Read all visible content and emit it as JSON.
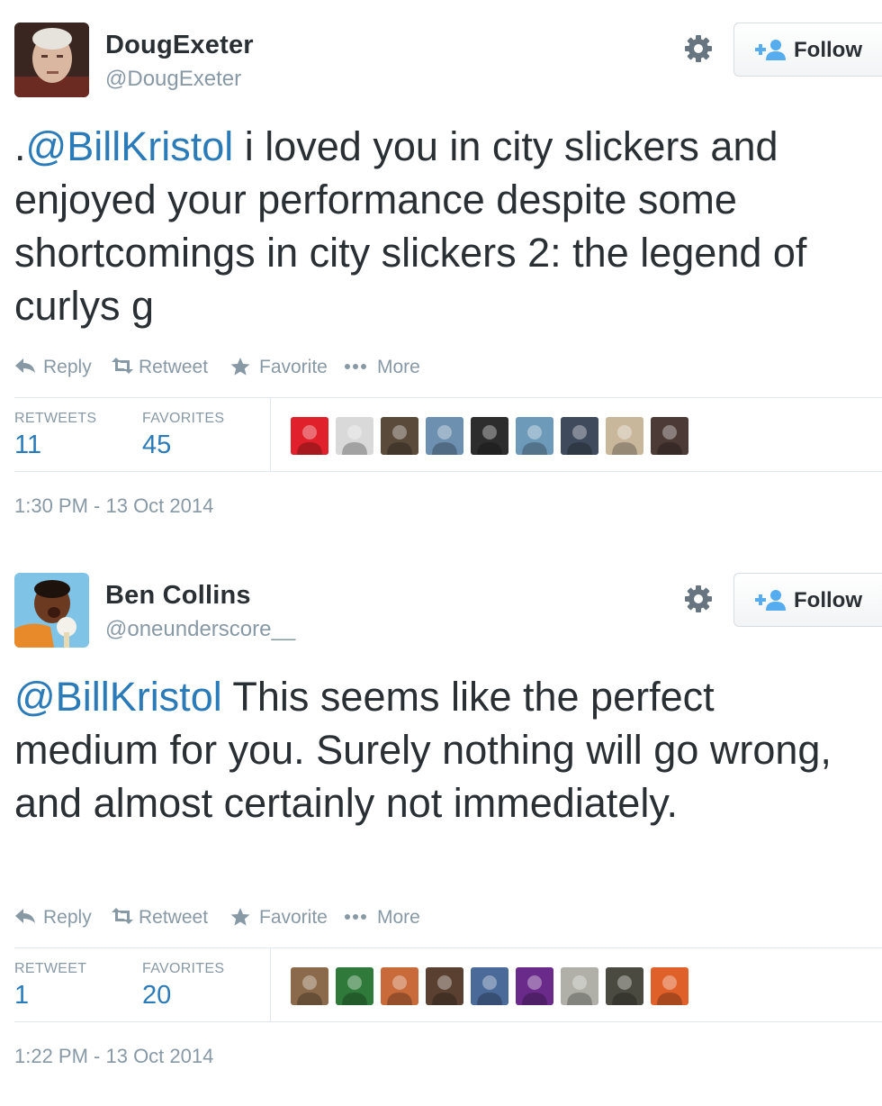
{
  "tweets": [
    {
      "author": {
        "fullname": "DougExeter",
        "username": "@DougExeter"
      },
      "follow_label": "Follow",
      "text": {
        "prefix": ".",
        "mention": "@BillKristol",
        "rest": " i loved you in city slickers and enjoyed your performance despite some shortcomings in city slickers 2: the legend of curlys g"
      },
      "actions": {
        "reply": "Reply",
        "retweet": "Retweet",
        "favorite": "Favorite",
        "more": "More"
      },
      "stats": {
        "retweets_label": "RETWEETS",
        "retweets_value": "11",
        "favorites_label": "FAVORITES",
        "favorites_value": "45"
      },
      "timestamp": "1:30 PM - 13 Oct 2014",
      "favoriter_avatar_colors": [
        "#e0202a",
        "#d9d9d9",
        "#5a4a3a",
        "#6d8fb0",
        "#2d2d2d",
        "#6e9ab9",
        "#3f4b5c",
        "#c9b79c",
        "#4b3a35"
      ]
    },
    {
      "author": {
        "fullname": "Ben Collins",
        "username": "@oneunderscore__"
      },
      "follow_label": "Follow",
      "text": {
        "prefix": "",
        "mention": "@BillKristol",
        "rest": " This seems like the perfect medium for you. Surely nothing will go wrong, and almost certainly not immediately."
      },
      "actions": {
        "reply": "Reply",
        "retweet": "Retweet",
        "favorite": "Favorite",
        "more": "More"
      },
      "stats": {
        "retweets_label": "RETWEET",
        "retweets_value": "1",
        "favorites_label": "FAVORITES",
        "favorites_value": "20"
      },
      "timestamp": "1:22 PM - 13 Oct 2014",
      "favoriter_avatar_colors": [
        "#8a6a4a",
        "#2f7a3a",
        "#c86a3a",
        "#5a4030",
        "#4a6a9a",
        "#6a2a8a",
        "#b0b0a8",
        "#4a4a40",
        "#e0602a"
      ]
    }
  ]
}
